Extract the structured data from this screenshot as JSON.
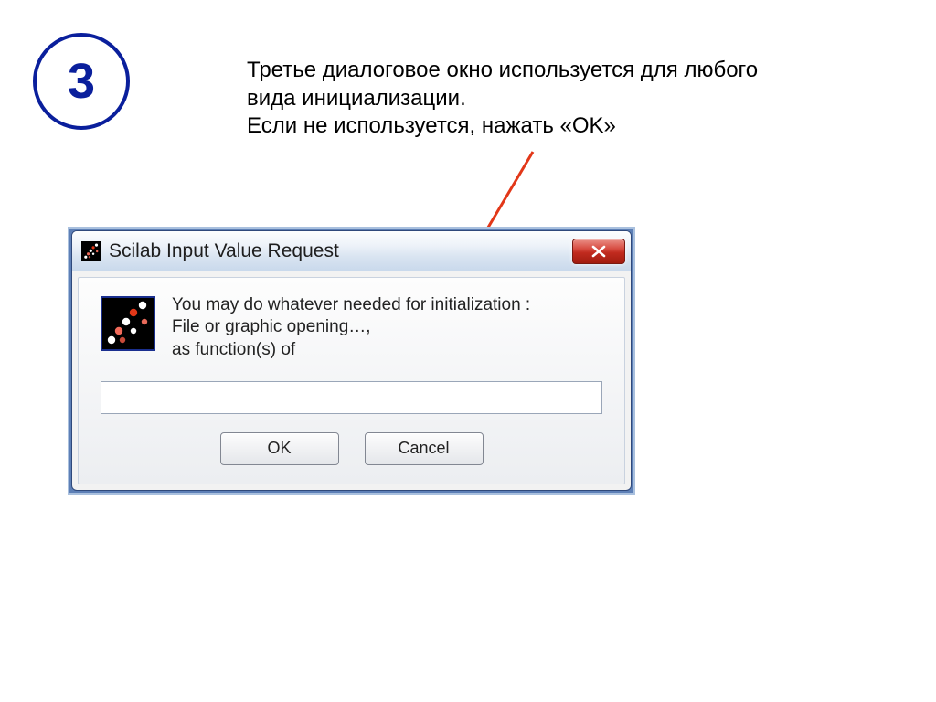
{
  "step": {
    "number": "3"
  },
  "description": {
    "line1": "Третье диалоговое окно используется для любого вида инициализации.",
    "line2": "Если не используется, нажать «OK»"
  },
  "dialog": {
    "title": "Scilab Input Value Request",
    "message_line1": "You may do whatever needed for initialization :",
    "message_line2": "File or graphic opening…,",
    "message_line3": "as function(s) of",
    "input_value": "",
    "ok_label": "OK",
    "cancel_label": "Cancel"
  },
  "colors": {
    "badge": "#0a1f9c",
    "arrow": "#e23718"
  }
}
